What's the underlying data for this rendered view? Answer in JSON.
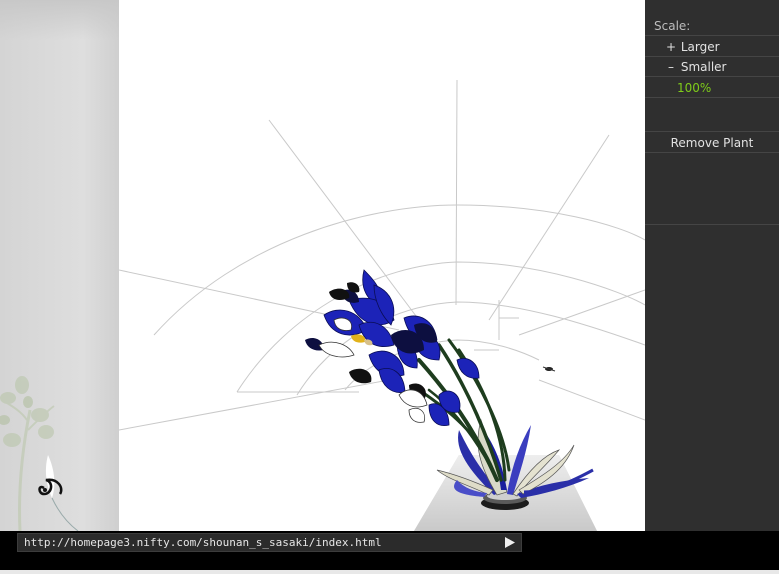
{
  "controls": {
    "scale_label": "Scale:",
    "larger": {
      "symbol": "+",
      "label": "Larger"
    },
    "smaller": {
      "symbol": "–",
      "label": "Smaller"
    },
    "zoom_value": "100%",
    "remove_label": "Remove Plant"
  },
  "address_bar": {
    "url": "http://homepage3.nifty.com/shounan_s_sasaki/index.html",
    "go_icon": "play-arrow-icon"
  },
  "colors": {
    "panel_bg": "#2f2f2f",
    "zoom_accent": "#7fcc1a",
    "flower_blue": "#1c23b8",
    "stem_green": "#1e3d1e",
    "stage_bg": "#ffffff"
  },
  "icons": {
    "tray_plant": "plant-sprig-icon",
    "tray_tendril": "tendril-icon",
    "arrangement": "ikebana-arrangement-icon",
    "insect": "small-insect-icon"
  }
}
